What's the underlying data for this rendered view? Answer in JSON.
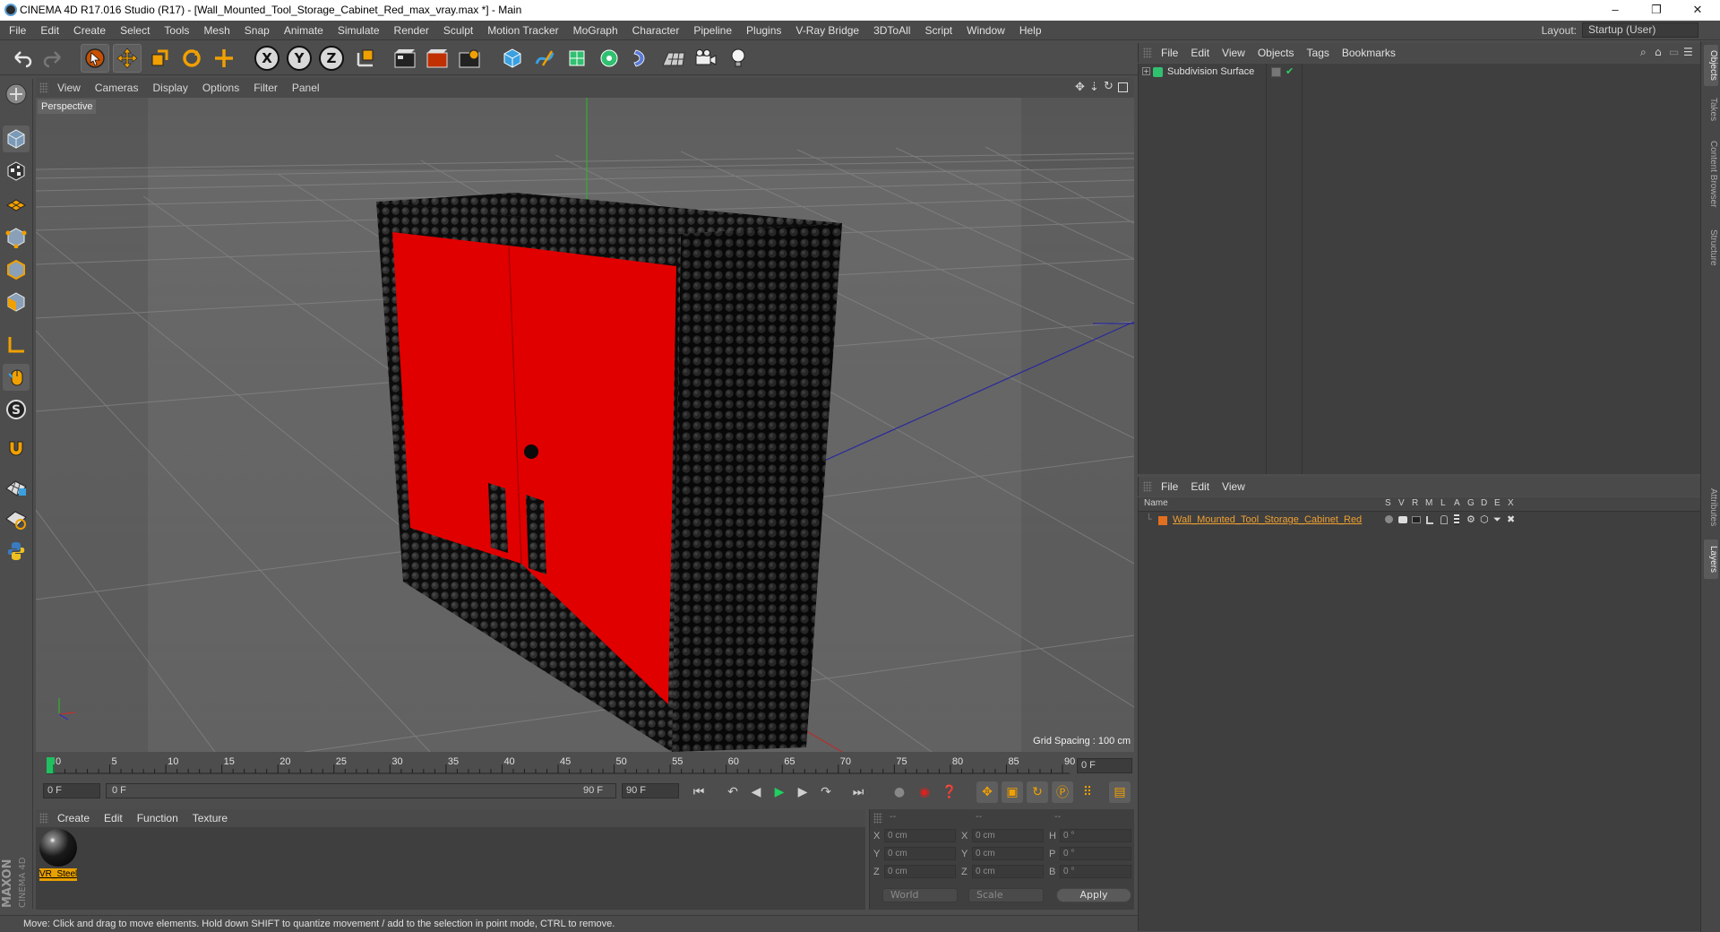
{
  "window": {
    "title": "CINEMA 4D R17.016 Studio (R17) - [Wall_Mounted_Tool_Storage_Cabinet_Red_max_vray.max *] - Main",
    "minimize": "–",
    "restore": "❐",
    "close": "✕"
  },
  "menubar": {
    "items": [
      "File",
      "Edit",
      "Create",
      "Select",
      "Tools",
      "Mesh",
      "Snap",
      "Animate",
      "Simulate",
      "Render",
      "Sculpt",
      "Motion Tracker",
      "MoGraph",
      "Character",
      "Pipeline",
      "Plugins",
      "V-Ray Bridge",
      "3DToAll",
      "Script",
      "Window",
      "Help"
    ],
    "layout_label": "Layout:",
    "layout_value": "Startup (User)"
  },
  "toolbar": {
    "axis_x": "X",
    "axis_y": "Y",
    "axis_z": "Z"
  },
  "viewport": {
    "menu": [
      "View",
      "Cameras",
      "Display",
      "Options",
      "Filter",
      "Panel"
    ],
    "label": "Perspective",
    "grid_spacing": "Grid Spacing : 100 cm"
  },
  "timeline": {
    "ticks": [
      "0",
      "5",
      "10",
      "15",
      "20",
      "25",
      "30",
      "35",
      "40",
      "45",
      "50",
      "55",
      "60",
      "65",
      "70",
      "75",
      "80",
      "85",
      "90"
    ],
    "current_frame": "0 F",
    "start_field": "0 F",
    "slider_start": "0 F",
    "slider_end": "90 F",
    "end_field": "90 F"
  },
  "materials": {
    "menu": [
      "Create",
      "Edit",
      "Function",
      "Texture"
    ],
    "items": [
      {
        "name": "VR_Steel"
      }
    ]
  },
  "coordinates": {
    "header": [
      "--",
      "--",
      "--"
    ],
    "rows": [
      {
        "l1": "X",
        "v1": "0 cm",
        "l2": "X",
        "v2": "0 cm",
        "l3": "H",
        "v3": "0 °"
      },
      {
        "l1": "Y",
        "v1": "0 cm",
        "l2": "Y",
        "v2": "0 cm",
        "l3": "P",
        "v3": "0 °"
      },
      {
        "l1": "Z",
        "v1": "0 cm",
        "l2": "Z",
        "v2": "0 cm",
        "l3": "B",
        "v3": "0 °"
      }
    ],
    "mode": "World",
    "transform": "Scale",
    "apply": "Apply"
  },
  "status": {
    "text": "Move: Click and drag to move elements. Hold down SHIFT to quantize movement / add to the selection in point mode, CTRL to remove."
  },
  "logo": {
    "maxon": "MAXON",
    "cinema": "CINEMA 4D"
  },
  "objects_panel": {
    "menu": [
      "File",
      "Edit",
      "View",
      "Objects",
      "Tags",
      "Bookmarks"
    ],
    "items": [
      {
        "name": "Subdivision Surface"
      }
    ]
  },
  "layers_panel": {
    "menu": [
      "File",
      "Edit",
      "View"
    ],
    "columns": {
      "name": "Name",
      "flags": [
        "S",
        "V",
        "R",
        "M",
        "L",
        "A",
        "G",
        "D",
        "E",
        "X"
      ]
    },
    "items": [
      {
        "name": "Wall_Mounted_Tool_Storage_Cabinet_Red",
        "color": "#e07020"
      }
    ]
  },
  "side_tabs": [
    "Objects",
    "Takes",
    "Content Browser",
    "Structure",
    "Attributes",
    "Layers"
  ],
  "colors": {
    "cabinet_red": "#e00000",
    "accent_orange": "#e8a000",
    "layer_text": "#f0a030"
  }
}
